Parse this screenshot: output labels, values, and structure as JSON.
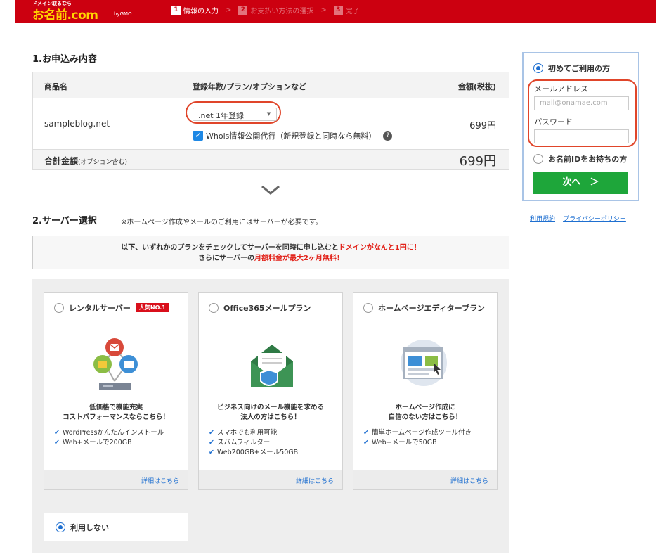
{
  "header": {
    "logo_tagline": "ドメイン取るなら",
    "logo": "お名前.com",
    "logo_sub": "byGMO",
    "steps": [
      {
        "num": "1",
        "label": "情報の入力"
      },
      {
        "num": "2",
        "label": "お支払い方法の選択"
      },
      {
        "num": "3",
        "label": "完了"
      }
    ],
    "step_separator": ">"
  },
  "section1": {
    "title": "1.お申込み内容",
    "columns": {
      "product": "商品名",
      "plan": "登録年数/プラン/オプションなど",
      "price": "金額(税抜)"
    },
    "row": {
      "domain": "sampleblog.net",
      "plan_select": ".net 1年登録",
      "whois_label": "Whois情報公開代行（新規登録と同時なら無料）",
      "price": "699円"
    },
    "total": {
      "label": "合計金額",
      "note": "(オプション含む)",
      "price": "699円"
    }
  },
  "section2": {
    "title": "2.サーバー選択",
    "note": "※ホームページ作成やメールのご利用にはサーバーが必要です。",
    "notice": {
      "line1_a": "以下、いずれかのプランをチェックしてサーバーを同時に申し込むと",
      "line1_b": "ドメインがなんと1円に！",
      "line2_a": "さらにサーバーの",
      "line2_b": "月額料金が最大2ヶ月無料！"
    },
    "plans": [
      {
        "title": "レンタルサーバー",
        "badge": "人気NO.1",
        "desc1": "低価格で機能充実",
        "desc2": "コストパフォーマンスならこちら！",
        "features": [
          "WordPressかんたんインストール",
          "Web+メールで200GB"
        ],
        "link": "詳細はこちら"
      },
      {
        "title": "Office365メールプラン",
        "desc1": "ビジネス向けのメール機能を求める",
        "desc2": "法人の方はこちら！",
        "features": [
          "スマホでも利用可能",
          "スパムフィルター",
          "Web200GB+メール50GB"
        ],
        "link": "詳細はこちら"
      },
      {
        "title": "ホームページエディタープラン",
        "desc1": "ホームページ作成に",
        "desc2": "自信のない方はこちら！",
        "features": [
          "簡単ホームページ作成ツール付き",
          "Web+メールで50GB"
        ],
        "link": "詳細はこちら"
      }
    ],
    "no_use": "利用しない"
  },
  "login": {
    "first_time": "初めてご利用の方",
    "email_label": "メールアドレス",
    "email_placeholder": "mail@onamae.com",
    "password_label": "パスワード",
    "have_id": "お名前IDをお持ちの方",
    "next_button": "次へ　＞"
  },
  "footer_links": {
    "terms": "利用規約",
    "privacy": "プライバシーポリシー"
  },
  "colors": {
    "brand_red": "#cc0010",
    "logo_yellow": "#ffd400",
    "accent_blue": "#1e6fd0",
    "next_green": "#1ea63a",
    "highlight_orange": "#e0452a"
  }
}
